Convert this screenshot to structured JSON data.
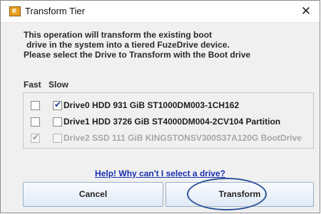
{
  "window": {
    "title": "Transform Tier",
    "icon": "app-fuzedrive-icon",
    "close_glyph": "✕"
  },
  "description": {
    "lines": [
      "This operation will transform the existing boot",
      "drive in the system into a tiered FuzeDrive device.",
      "Please select the Drive to Transform with the Boot drive"
    ]
  },
  "columns": {
    "fast": "Fast",
    "slow": "Slow"
  },
  "drives": [
    {
      "fast_checked": false,
      "fast_enabled": true,
      "slow_checked": true,
      "slow_enabled": true,
      "label": "Drive0  HDD  931 GiB  ST1000DM003-1CH162"
    },
    {
      "fast_checked": false,
      "fast_enabled": true,
      "slow_checked": false,
      "slow_enabled": true,
      "label": "Drive1  HDD  3726 GiB  ST4000DM004-2CV104 Partition"
    },
    {
      "fast_checked": true,
      "fast_enabled": false,
      "slow_checked": false,
      "slow_enabled": false,
      "label": "Drive2  SSD  111 GiB  KINGSTONSV300S37A120G BootDrive"
    }
  ],
  "help_link": "Help! Why can't I select a drive?",
  "buttons": {
    "cancel": "Cancel",
    "transform": "Transform"
  },
  "colors": {
    "link": "#1a2fb0",
    "highlight_oval": "#2f5597",
    "arrow": "#9ecf85"
  }
}
